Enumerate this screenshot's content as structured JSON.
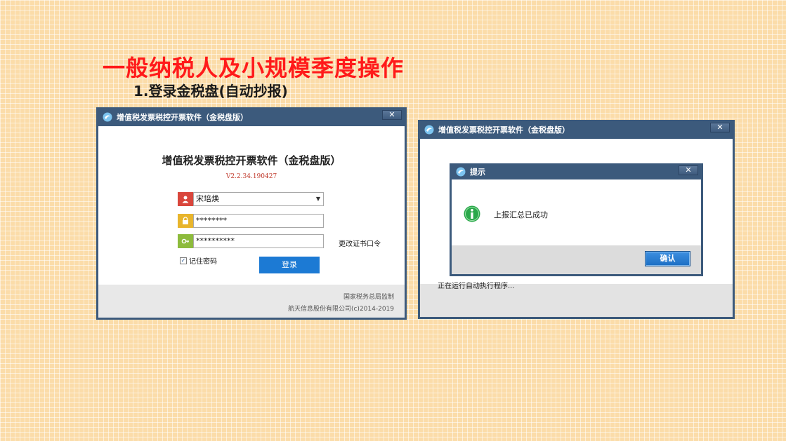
{
  "slide": {
    "title": "一般纳税人及小规模季度操作",
    "subtitle": "1.登录金税盘(自动抄报)"
  },
  "login_window": {
    "title": "增值税发票税控开票软件（金税盘版）",
    "close_label": "✕",
    "heading": "增值税发票税控开票软件（金税盘版）",
    "version": "V2.2.34.190427",
    "user_value": "宋培焕",
    "password_value": "********",
    "cert_password_value": "**********",
    "change_pin_label": "更改证书口令",
    "remember_label": "记住密码",
    "remember_checked": "✓",
    "login_label": "登录",
    "footer_line1": "国家税务总局监制",
    "footer_line2": "航天信息股份有限公司(c)2014-2019"
  },
  "running_window": {
    "title": "增值税发票税控开票软件（金税盘版）",
    "close_label": "✕",
    "status_text": "正在运行自动执行程序..."
  },
  "prompt_dialog": {
    "title": "提示",
    "close_label": "✕",
    "message": "上报汇总已成功",
    "ok_label": "确认"
  },
  "colors": {
    "title_red": "#ff1a1a",
    "window_frame": "#3c5a7c",
    "login_button": "#1c7ad4",
    "user_icon": "#d9463c",
    "lock_icon": "#e8b52c",
    "key_icon": "#8dbb3c",
    "info_green": "#2aa84a"
  },
  "icons": {
    "app": "app-logo-icon",
    "user": "user-icon",
    "lock": "lock-icon",
    "key": "key-icon",
    "info": "info-icon"
  }
}
